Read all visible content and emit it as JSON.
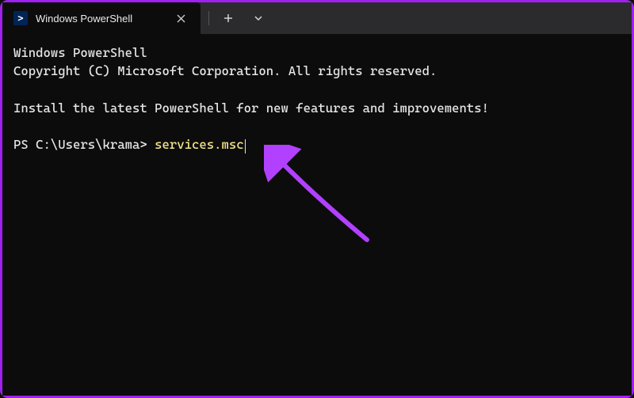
{
  "titlebar": {
    "tab": {
      "title": "Windows PowerShell",
      "icon_glyph": ">_"
    }
  },
  "terminal": {
    "line1": "Windows PowerShell",
    "line2": "Copyright (C) Microsoft Corporation. All rights reserved.",
    "blank1": "",
    "line3": "Install the latest PowerShell for new features and improvements!",
    "blank2": "",
    "prompt": "PS C:\\Users\\krama> ",
    "command": "services.msc"
  },
  "colors": {
    "accent_border": "#a020f0",
    "command_fg": "#f4e58a",
    "arrow": "#b140ff"
  }
}
